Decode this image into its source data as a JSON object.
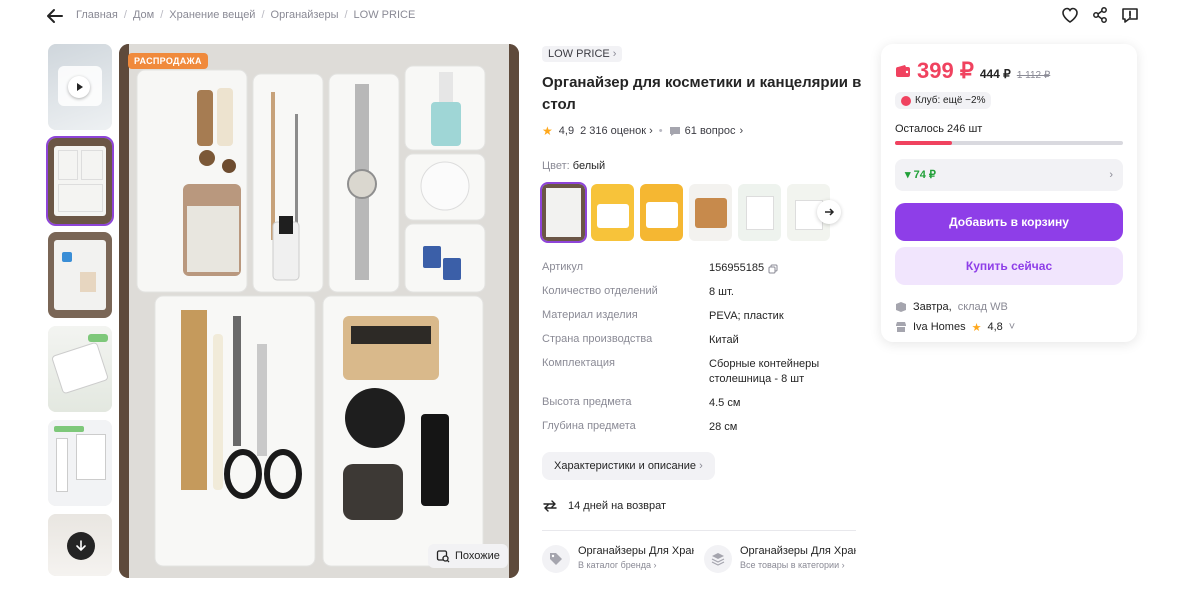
{
  "breadcrumb": [
    "Главная",
    "Дом",
    "Хранение вещей",
    "Органайзеры",
    "LOW PRICE"
  ],
  "gallery": {
    "sale_badge": "РАСПРОДАЖА",
    "similar_label": "Похожие"
  },
  "product": {
    "brand": "LOW PRICE",
    "title": "Органайзер для косметики и канцелярии в стол",
    "rating": "4,9",
    "reviews": "2 316 оценок",
    "questions": "61 вопрос",
    "color_label": "Цвет:",
    "color_value": "белый"
  },
  "specs": [
    {
      "k": "Артикул",
      "v": "156955185"
    },
    {
      "k": "Количество отделений",
      "v": "8 шт."
    },
    {
      "k": "Материал изделия",
      "v": "PEVA; пластик"
    },
    {
      "k": "Страна производства",
      "v": "Китай"
    },
    {
      "k": "Комплектация",
      "v": "Сборные контейнеры столешница - 8 шт"
    },
    {
      "k": "Высота предмета",
      "v": "4.5 см"
    },
    {
      "k": "Глубина предмета",
      "v": "28 см"
    }
  ],
  "chars_button": "Характеристики и описание",
  "return_text": "14 дней на возврат",
  "categories": [
    {
      "title": "Органайзеры Для Хранения",
      "sub": "В каталог бренда"
    },
    {
      "title": "Органайзеры Для Хранения",
      "sub": "Все товары в категории"
    }
  ],
  "buy": {
    "price": "399 ₽",
    "price_wallet": "444 ₽",
    "price_old": "1 112 ₽",
    "club": "Клуб: ещё −2%",
    "stock": "Осталось 246 шт",
    "stock_fraction": 0.25,
    "credit": "74 ₽",
    "add_to_cart": "Добавить в корзину",
    "buy_now": "Купить сейчас",
    "delivery_day": "Завтра,",
    "delivery_where": "склад WB",
    "seller": "Iva Homes",
    "seller_rating": "4,8"
  },
  "colors": {
    "accent": "#8e3ee8",
    "price": "#f0425f",
    "star": "#ffa81c"
  }
}
